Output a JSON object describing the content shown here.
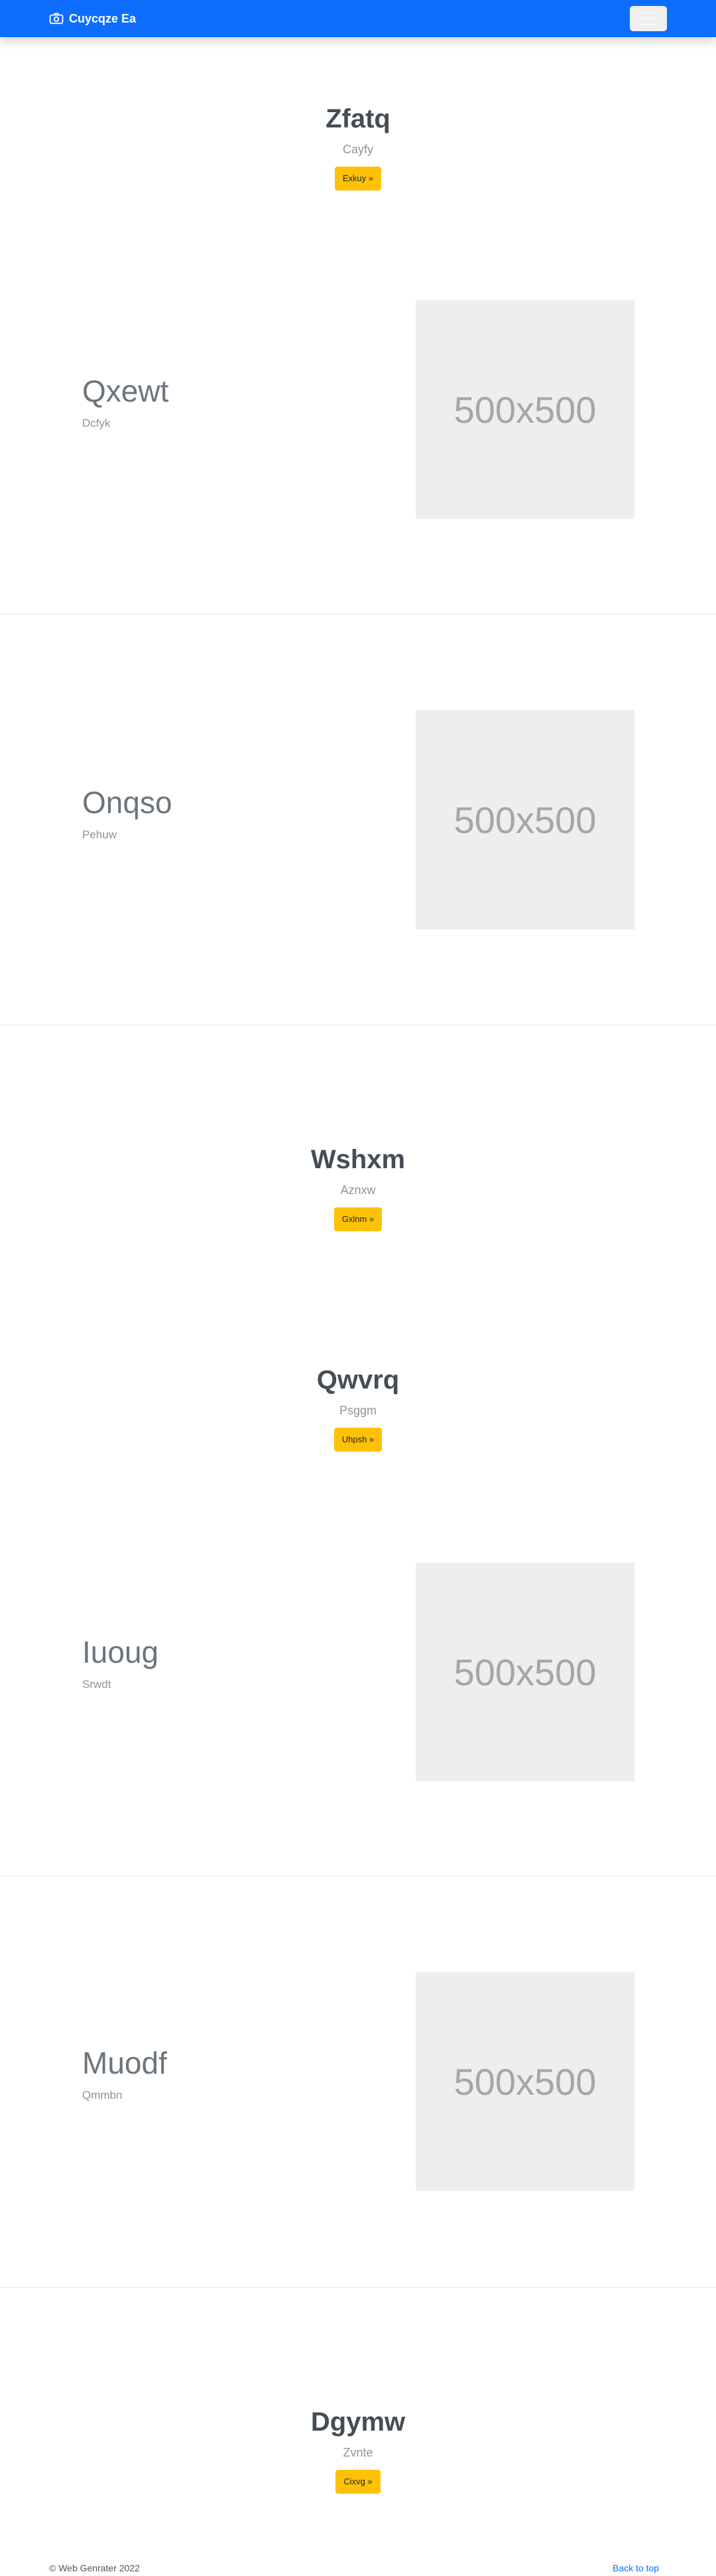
{
  "navbar": {
    "brand": "Cuycqze Ea",
    "brand_icon": "camera-icon",
    "toggle_icon": "hamburger-icon",
    "color": "#0d6efd"
  },
  "heroes": [
    {
      "title": "Zfatq",
      "subtitle": "Cayfy",
      "button": "Exkuy »"
    },
    {
      "title": "Wshxm",
      "subtitle": "Aznxw",
      "button": "Gxlnm »"
    },
    {
      "title": "Qwvrq",
      "subtitle": "Psggm",
      "button": "Uhpsh »"
    },
    {
      "title": "Dgymw",
      "subtitle": "Zvnte",
      "button": "Cixvg »"
    }
  ],
  "features": [
    {
      "title": "Qxewt",
      "subtitle": "Dcfyk",
      "image_label": "500x500"
    },
    {
      "title": "Onqso",
      "subtitle": "Pehuw",
      "image_label": "500x500"
    },
    {
      "title": "Iuoug",
      "subtitle": "Srwdt",
      "image_label": "500x500"
    },
    {
      "title": "Muodf",
      "subtitle": "Qmmbn",
      "image_label": "500x500"
    }
  ],
  "footer": {
    "copyright": "© Web Genrater 2022",
    "back_to_top": "Back to top"
  }
}
